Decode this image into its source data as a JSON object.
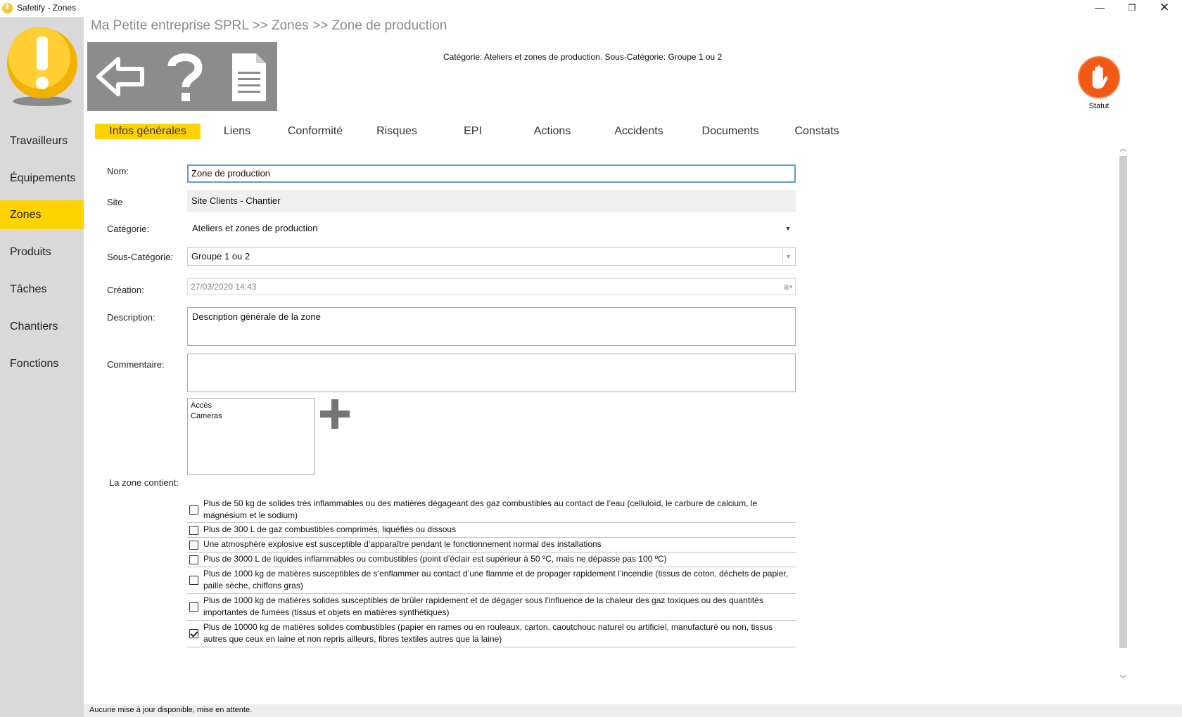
{
  "window": {
    "title": "Safetify - Zones",
    "min_label": "—",
    "max_label": "❐",
    "close_label": "✕"
  },
  "sidebar": {
    "items": [
      {
        "label": "Travailleurs"
      },
      {
        "label": "Équipements"
      },
      {
        "label": "Zones",
        "active": true
      },
      {
        "label": "Produits"
      },
      {
        "label": "Tâches"
      },
      {
        "label": "Chantiers"
      },
      {
        "label": "Fonctions"
      }
    ]
  },
  "header": {
    "breadcrumb": "Ma Petite entreprise SPRL >> Zones >> Zone de production",
    "category_line": "Catégorie: Ateliers et zones de production. Sous-Catégorie: Groupe 1 ou 2",
    "statut_label": "Statut",
    "toolbar_icons": [
      "back-arrow-icon",
      "help-icon",
      "document-icon"
    ],
    "statut_icon": "stop-hand-icon",
    "accent_color": "#ffd200",
    "statut_color": "#f05a14"
  },
  "tabs": [
    {
      "label": "Infos générales",
      "active": true
    },
    {
      "label": "Liens"
    },
    {
      "label": "Conformité"
    },
    {
      "label": "Risques"
    },
    {
      "label": "EPI"
    },
    {
      "label": "Actions"
    },
    {
      "label": "Accidents"
    },
    {
      "label": "Documents"
    },
    {
      "label": "Constats"
    }
  ],
  "form": {
    "nom": {
      "label": "Nom:",
      "value": "Zone de production"
    },
    "site": {
      "label": "Site",
      "value": "Site Clients - Chantier"
    },
    "categorie": {
      "label": "Catégorie:",
      "value": "Ateliers et zones de production"
    },
    "sous_categorie": {
      "label": "Sous-Catégorie:",
      "value": "Groupe 1 ou 2"
    },
    "creation": {
      "label": "Création:",
      "value": "27/03/2020 14:43"
    },
    "description": {
      "label": "Description:",
      "value": "Description générale de la zone"
    },
    "commentaire": {
      "label": "Commentaire:",
      "value": ""
    },
    "list_items": [
      "Accès",
      "Cameras"
    ],
    "zone_contient_label": "La zone contient:"
  },
  "checklist": [
    {
      "text": "Plus de 50 kg de solides très inflammables ou des matières dégageant des gaz combustibles au contact de l’eau (celluloïd, le carbure de calcium, le magnésium et le sodium)",
      "checked": false
    },
    {
      "text": "Plus de 300 L de gaz combustibles comprimés, liquéfiés ou dissous",
      "checked": false
    },
    {
      "text": "Une atmosphère explosive est susceptible d’apparaître pendant le fonctionnement normal des installations",
      "checked": false
    },
    {
      "text": "Plus de 3000 L de liquides inflammables ou combustibles (point d’éclair est supérieur à 50 ºC, mais ne dépasse pas 100 ºC)",
      "checked": false
    },
    {
      "text": "Plus de 1000 kg de matières susceptibles de s’enflammer au contact d’une flamme et de propager rapidement l’incendie (tissus de coton, déchets de papier, paille sèche, chiffons gras)",
      "checked": false
    },
    {
      "text": "Plus de 1000 kg de matières solides susceptibles de brûler rapidement et de dégager sous l’influence de la chaleur des gaz toxiques ou des quantités importantes de fumées (tissus et objets en matières synthétiques)",
      "checked": false
    },
    {
      "text": "Plus de 10000 kg de matières solides combustibles (papier en rames ou en rouleaux, carton, caoutchouc naturel ou artificiel, manufacturé ou non, tissus autres que ceux en laine et non repris ailleurs, fibres textiles autres que la laine)",
      "checked": true
    }
  ],
  "status_bar": {
    "text": "Aucune mise à jour disponible, mise en attente."
  }
}
